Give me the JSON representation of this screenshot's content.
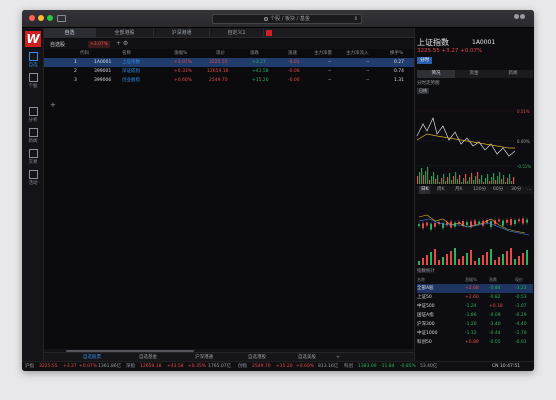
{
  "titlebar": {
    "search_text": "个股 / 板块 / 基金",
    "scroll_glyph": "⇕"
  },
  "app": {
    "logo": "W"
  },
  "nav": [
    {
      "label": "自选",
      "icon": "star-icon",
      "active": true
    },
    {
      "label": "个股",
      "icon": "candlestick-icon",
      "active": false
    },
    {
      "label": "分析",
      "icon": "chart-icon",
      "active": false
    },
    {
      "label": "新闻",
      "icon": "news-icon",
      "active": false
    },
    {
      "label": "交易",
      "icon": "trade-icon",
      "active": false
    },
    {
      "label": "活动",
      "icon": "activity-icon",
      "active": false
    }
  ],
  "tabs": [
    {
      "label": "自选",
      "active": true
    },
    {
      "label": "全部港股",
      "active": false
    },
    {
      "label": "沪深港通",
      "active": false
    },
    {
      "label": "自定义1",
      "active": false
    }
  ],
  "toolbar": {
    "group_label": "自选股",
    "group_change": "+3.07%",
    "ops": "+  ⚙"
  },
  "table": {
    "columns": [
      "",
      "代码",
      "名称",
      "涨幅%",
      "现价",
      "涨跌",
      "涨速",
      "主力净量",
      "主力净流入",
      "换手%"
    ],
    "rows": [
      {
        "index": "1",
        "code": "1A0001",
        "name": "上证指数",
        "change_pct": "+3.07%",
        "price": "3225.55",
        "change": "+3.27",
        "speed": "-0.01",
        "net_volume": "--",
        "net_inflow": "--",
        "turnover": "0.27"
      },
      {
        "index": "2",
        "code": "399001",
        "name": "深证成指",
        "change_pct": "+0.33%",
        "price": "12659.18",
        "change": "+43.58",
        "speed": "-0.08",
        "net_volume": "--",
        "net_inflow": "--",
        "turnover": "0.74"
      },
      {
        "index": "3",
        "code": "399006",
        "name": "创业板指",
        "change_pct": "+0.60%",
        "price": "2549.70",
        "change": "+15.20",
        "speed": "-0.06",
        "net_volume": "--",
        "net_inflow": "--",
        "turnover": "1.31"
      }
    ],
    "add_glyph": "+"
  },
  "bottom_tabs": [
    {
      "label": "自选股票",
      "active": true
    },
    {
      "label": "自选基金",
      "active": false
    },
    {
      "label": "沪深港通",
      "active": false
    },
    {
      "label": "自选港股",
      "active": false
    },
    {
      "label": "自选美股",
      "active": false
    },
    {
      "label": "+",
      "active": false
    }
  ],
  "statusbar": {
    "sh_label": "沪指",
    "sh_price": "3225.55",
    "sh_change": "+3.27",
    "sh_pct": "+0.07%",
    "sh_amount": "1361.86亿",
    "sz_label": "深指",
    "sz_price": "12659.18",
    "sz_change": "+43.58",
    "sz_pct": "+0.35%",
    "sz_amount": "1765.07亿",
    "cy_label": "创指",
    "cy_price": "2549.70",
    "cy_change": "+15.20",
    "cy_pct": "+0.60%",
    "cy_amount": "813.16亿",
    "kc_label": "科创",
    "kc_price": "1383.09",
    "kc_change": "-11.84",
    "kc_pct": "-0.85%",
    "kc_amount": "53.40亿",
    "clock": "CN 10:47:51"
  },
  "right_panel": {
    "title": "上证指数",
    "code": "1A0001",
    "price_line": "3225.55 +3.27 +0.07%",
    "tag": "分时",
    "tabs": [
      "简况",
      "资金",
      "新闻"
    ],
    "mini_title": "分时走势图",
    "mini_btn": "日线",
    "mini_axis": {
      "upper": "0.51%",
      "middle": "0.00%",
      "lower": "-0.51%"
    },
    "periods": [
      {
        "label": "日K",
        "active": true
      },
      {
        "label": "周K",
        "active": false
      },
      {
        "label": "月K",
        "active": false
      },
      {
        "label": "120分",
        "active": false
      },
      {
        "label": "60分",
        "active": false
      },
      {
        "label": "30分",
        "active": false
      },
      {
        "label": "…",
        "active": false
      }
    ],
    "indices_title": "指数统计",
    "indices_cols": [
      "名称",
      "涨幅%",
      "涨跌",
      "现价"
    ],
    "indices": [
      {
        "name": "全部A股",
        "a": "+2.68",
        "b": "-0.84",
        "c": "-3.23",
        "selected": true
      },
      {
        "name": "上证50",
        "a": "+2.60",
        "b": "-0.82",
        "c": "-0.53",
        "selected": false
      },
      {
        "name": "中证500",
        "a": "-1.24",
        "b": "+0.18",
        "c": "-1.07",
        "selected": false
      },
      {
        "name": "国证A指",
        "a": "-1.86",
        "b": "-0.09",
        "c": "-0.29",
        "selected": false
      },
      {
        "name": "沪深300",
        "a": "-1.20",
        "b": "-3.40",
        "c": "-4.40",
        "selected": false
      },
      {
        "name": "中证1000",
        "a": "-1.12",
        "b": "-0.44",
        "c": "-1.70",
        "selected": false
      },
      {
        "name": "科创50",
        "a": "+0.89",
        "b": "-0.05",
        "c": "-0.01",
        "selected": false
      }
    ]
  },
  "colors": {
    "up": "#e84848",
    "down": "#29b35e",
    "accent": "#3a8ee6",
    "brand": "#d01f1f"
  }
}
